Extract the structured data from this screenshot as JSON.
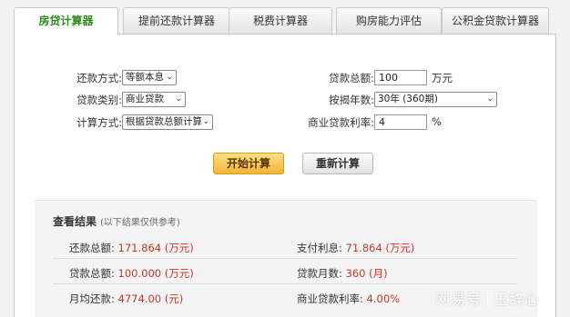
{
  "tabs": [
    {
      "label": "房贷计算器",
      "active": true
    },
    {
      "label": "提前还款计算器",
      "active": false
    },
    {
      "label": "税费计算器",
      "active": false
    },
    {
      "label": "购房能力评估",
      "active": false
    },
    {
      "label": "公积金贷款计算器",
      "active": false
    }
  ],
  "form": {
    "repay_method": {
      "label": "还款方式:",
      "value": "等额本息"
    },
    "loan_type": {
      "label": "贷款类别:",
      "value": "商业贷款"
    },
    "calc_method": {
      "label": "计算方式:",
      "value": "根据贷款总额计算"
    },
    "loan_total": {
      "label": "贷款总额:",
      "value": "100",
      "unit": "万元"
    },
    "term": {
      "label": "按揭年数:",
      "value": "30年 (360期)"
    },
    "rate": {
      "label": "商业贷款利率:",
      "value": "4",
      "unit": "%"
    }
  },
  "buttons": {
    "calculate": "开始计算",
    "recalculate": "重新计算"
  },
  "results": {
    "title": "查看结果",
    "note": "(以下结果仅供参考)",
    "total_repay": {
      "label": "还款总额:",
      "value": "171.864 (万元)"
    },
    "interest": {
      "label": "支付利息:",
      "value": "71.864 (万元)"
    },
    "loan_total": {
      "label": "贷款总额:",
      "value": "100.000 (万元)"
    },
    "months": {
      "label": "贷款月数:",
      "value": "360 (月)"
    },
    "monthly": {
      "label": "月均还款:",
      "value": "4774.00 (元)"
    },
    "rate": {
      "label": "商业贷款利率:",
      "value": "4.00%"
    }
  },
  "watermark": {
    "left": "网易号",
    "right": "玉辞心"
  },
  "colors": {
    "accent_green": "#2e8b1f",
    "value_red": "#c0392b",
    "button_orange": "#f3b431"
  }
}
